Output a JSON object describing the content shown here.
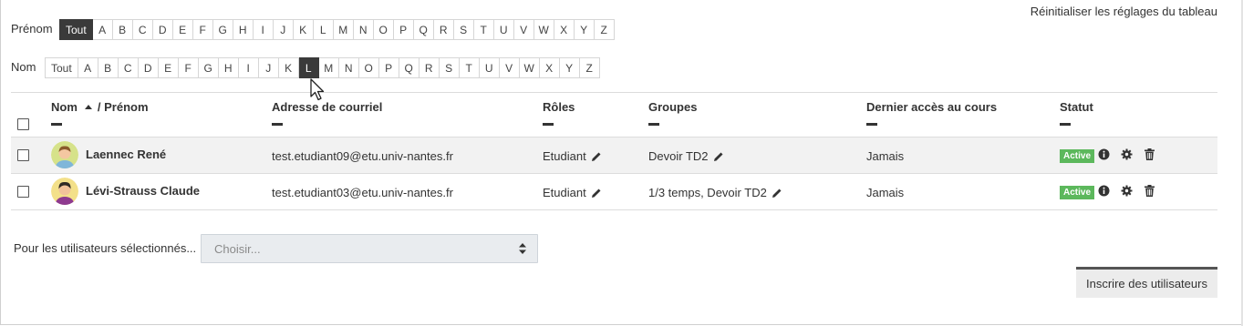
{
  "reset_link": "Réinitialiser les réglages du tableau",
  "firstname_filter": {
    "label": "Prénom",
    "items": [
      "Tout",
      "A",
      "B",
      "C",
      "D",
      "E",
      "F",
      "G",
      "H",
      "I",
      "J",
      "K",
      "L",
      "M",
      "N",
      "O",
      "P",
      "Q",
      "R",
      "S",
      "T",
      "U",
      "V",
      "W",
      "X",
      "Y",
      "Z"
    ],
    "active": "Tout"
  },
  "lastname_filter": {
    "label": "Nom",
    "items": [
      "Tout",
      "A",
      "B",
      "C",
      "D",
      "E",
      "F",
      "G",
      "H",
      "I",
      "J",
      "K",
      "L",
      "M",
      "N",
      "O",
      "P",
      "Q",
      "R",
      "S",
      "T",
      "U",
      "V",
      "W",
      "X",
      "Y",
      "Z"
    ],
    "active": "L"
  },
  "table": {
    "headers": {
      "name": "Nom",
      "firstname": "/ Prénom",
      "email": "Adresse de courriel",
      "roles": "Rôles",
      "groups": "Groupes",
      "last_access": "Dernier accès au cours",
      "status": "Statut"
    },
    "rows": [
      {
        "name": "Laennec René",
        "email": "test.etudiant09@etu.univ-nantes.fr",
        "role": "Etudiant",
        "groups": "Devoir TD2",
        "last_access": "Jamais",
        "status": "Active"
      },
      {
        "name": "Lévi-Strauss Claude",
        "email": "test.etudiant03@etu.univ-nantes.fr",
        "role": "Etudiant",
        "groups": "1/3 temps, Devoir TD2",
        "last_access": "Jamais",
        "status": "Active"
      }
    ]
  },
  "bulk": {
    "label": "Pour les utilisateurs sélectionnés...",
    "placeholder": "Choisir..."
  },
  "enrol_button": "Inscrire des utilisateurs",
  "colors": {
    "active_badge": "#5cb85c",
    "active_initial": "#3a3a3a"
  }
}
